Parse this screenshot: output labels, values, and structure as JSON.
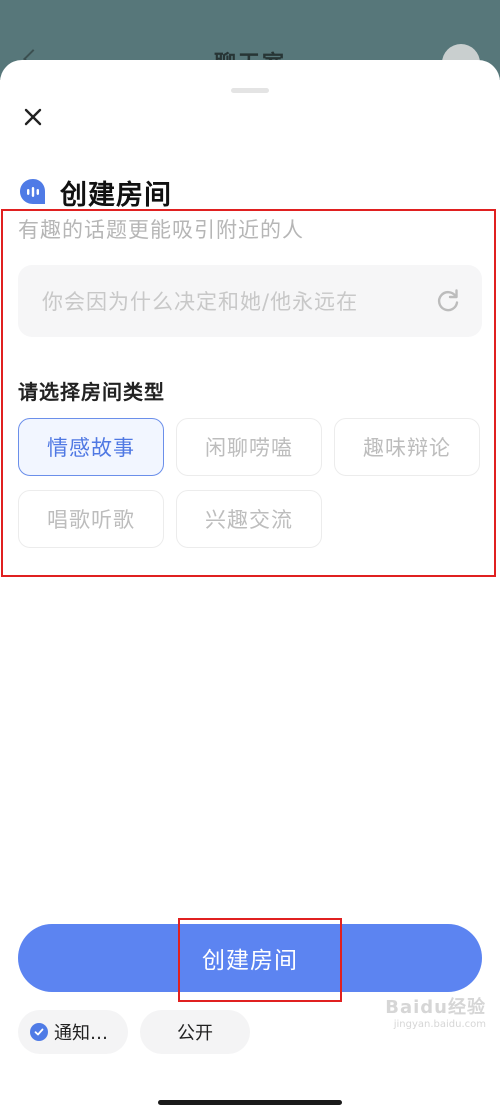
{
  "background": {
    "title": "聊天室"
  },
  "sheet": {
    "title": "创建房间",
    "subtitle": "有趣的话题更能吸引附近的人",
    "topic_input": {
      "placeholder": "你会因为什么决定和她/他永远在"
    },
    "room_type_label": "请选择房间类型",
    "room_types": [
      {
        "label": "情感故事",
        "selected": true
      },
      {
        "label": "闲聊唠嗑",
        "selected": false
      },
      {
        "label": "趣味辩论",
        "selected": false
      },
      {
        "label": "唱歌听歌",
        "selected": false
      },
      {
        "label": "兴趣交流",
        "selected": false
      }
    ],
    "create_button": "创建房间",
    "notify_pill": "通知…",
    "visibility_pill": "公开"
  },
  "watermark": {
    "brand": "Baidu经验",
    "domain": "jingyan.baidu.com"
  },
  "colors": {
    "accent": "#5c84f1",
    "selected_border": "#6b8fea",
    "annotation": "#e02020"
  }
}
